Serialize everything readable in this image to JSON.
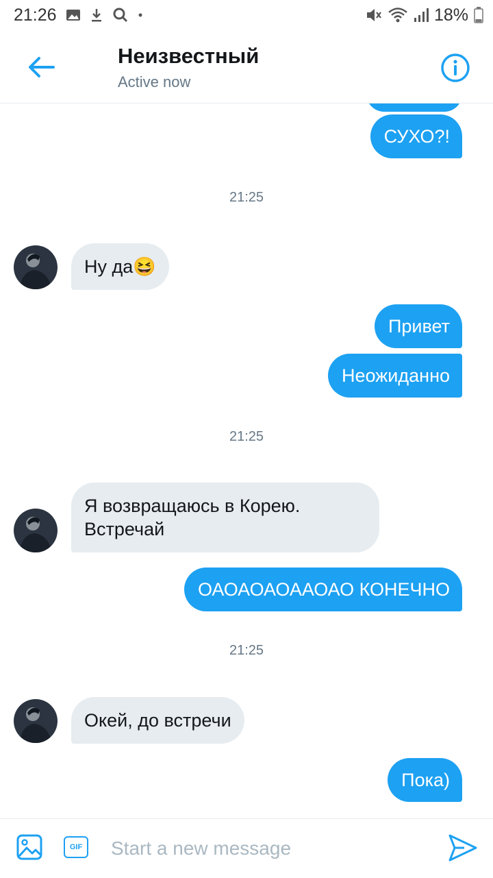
{
  "status_bar": {
    "time": "21:26",
    "battery": "18%"
  },
  "header": {
    "title": "Неизвестный",
    "subtitle": "Active now"
  },
  "colors": {
    "accent": "#1da1f2",
    "incoming_bubble": "#e6ecf0",
    "muted_text": "#657786"
  },
  "messages": [
    {
      "direction": "out",
      "text": ""
    },
    {
      "direction": "out",
      "text": "СУХО?!"
    },
    {
      "type": "timestamp",
      "text": "21:25"
    },
    {
      "direction": "in",
      "text": "Ну да😆"
    },
    {
      "direction": "out",
      "text": "Привет"
    },
    {
      "direction": "out",
      "text": "Неожиданно"
    },
    {
      "type": "timestamp",
      "text": "21:25"
    },
    {
      "direction": "in",
      "text": "Я возвращаюсь в Корею. Встречай"
    },
    {
      "direction": "out",
      "text": "ОАОАОАОААОАО КОНЕЧНО"
    },
    {
      "type": "timestamp",
      "text": "21:25"
    },
    {
      "direction": "in",
      "text": "Окей, до встречи"
    },
    {
      "direction": "out",
      "text": "Пока)"
    }
  ],
  "composer": {
    "placeholder": "Start a new message",
    "gif_label": "GIF"
  },
  "icons": [
    "back-arrow-icon",
    "info-icon",
    "image-icon",
    "gif-icon",
    "send-icon",
    "wifi-icon",
    "signal-icon",
    "battery-icon",
    "mute-icon"
  ]
}
